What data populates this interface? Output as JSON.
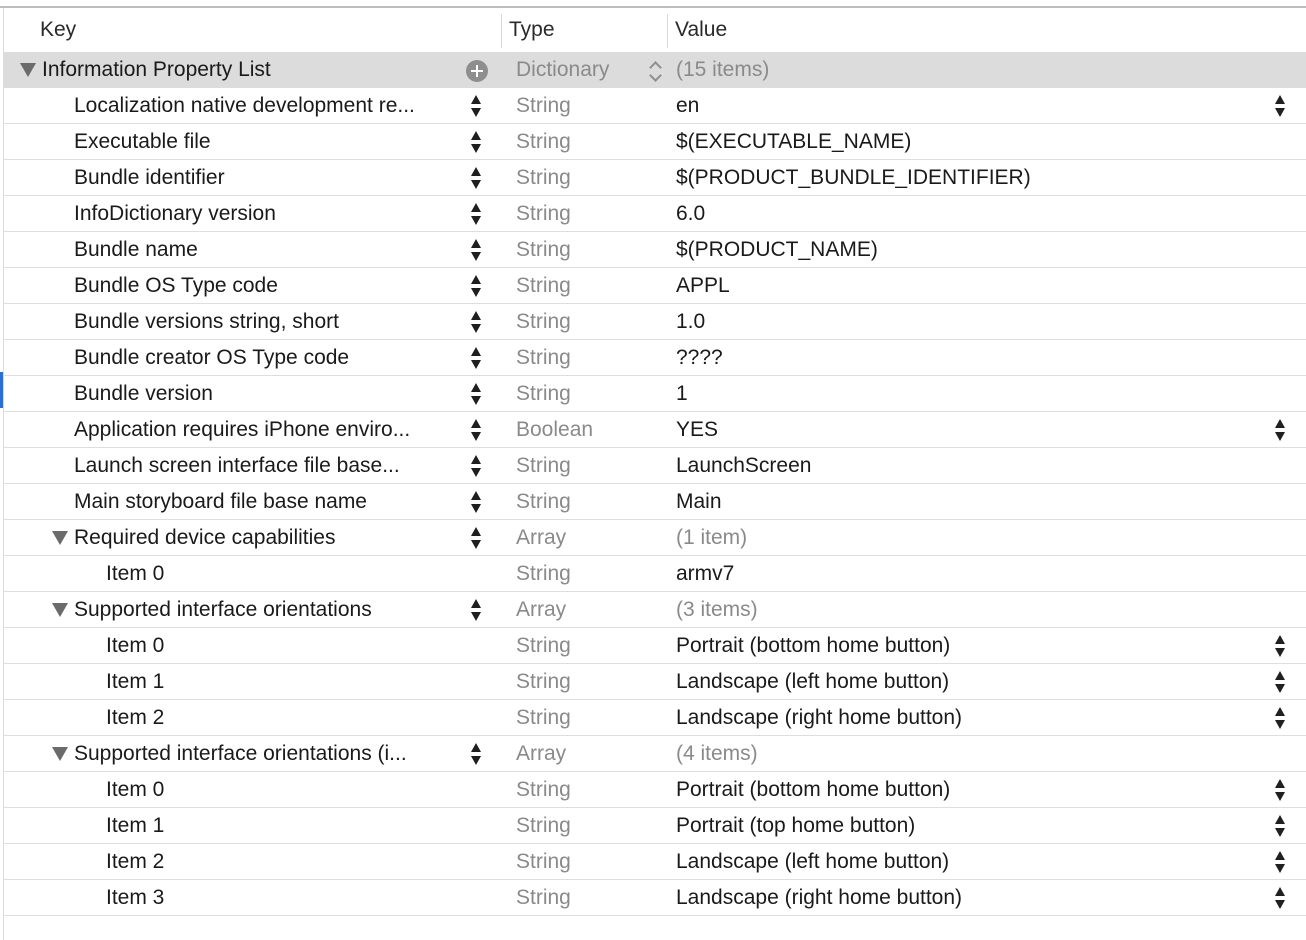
{
  "columns": {
    "key": "Key",
    "type": "Type",
    "value": "Value"
  },
  "root": {
    "key": "Information Property List",
    "type": "Dictionary",
    "value": "(15 items)"
  },
  "rows": [
    {
      "key": "Localization native development re...",
      "type": "String",
      "value": "en",
      "level": 1,
      "key_stepper": true,
      "value_stepper": true
    },
    {
      "key": "Executable file",
      "type": "String",
      "value": "$(EXECUTABLE_NAME)",
      "level": 1,
      "key_stepper": true
    },
    {
      "key": "Bundle identifier",
      "type": "String",
      "value": "$(PRODUCT_BUNDLE_IDENTIFIER)",
      "level": 1,
      "key_stepper": true
    },
    {
      "key": "InfoDictionary version",
      "type": "String",
      "value": "6.0",
      "level": 1,
      "key_stepper": true
    },
    {
      "key": "Bundle name",
      "type": "String",
      "value": "$(PRODUCT_NAME)",
      "level": 1,
      "key_stepper": true
    },
    {
      "key": "Bundle OS Type code",
      "type": "String",
      "value": "APPL",
      "level": 1,
      "key_stepper": true
    },
    {
      "key": "Bundle versions string, short",
      "type": "String",
      "value": "1.0",
      "level": 1,
      "key_stepper": true
    },
    {
      "key": "Bundle creator OS Type code",
      "type": "String",
      "value": "????",
      "level": 1,
      "key_stepper": true
    },
    {
      "key": "Bundle version",
      "type": "String",
      "value": "1",
      "level": 1,
      "key_stepper": true
    },
    {
      "key": "Application requires iPhone enviro...",
      "type": "Boolean",
      "value": "YES",
      "level": 1,
      "key_stepper": true,
      "value_stepper": true
    },
    {
      "key": "Launch screen interface file base...",
      "type": "String",
      "value": "LaunchScreen",
      "level": 1,
      "key_stepper": true
    },
    {
      "key": "Main storyboard file base name",
      "type": "String",
      "value": "Main",
      "level": 1,
      "key_stepper": true
    },
    {
      "key": "Required device capabilities",
      "type": "Array",
      "value": "(1 item)",
      "level": 1,
      "expanded": true,
      "key_stepper": true,
      "muted_value": true
    },
    {
      "key": "Item 0",
      "type": "String",
      "value": "armv7",
      "level": 2
    },
    {
      "key": "Supported interface orientations",
      "type": "Array",
      "value": "(3 items)",
      "level": 1,
      "expanded": true,
      "key_stepper": true,
      "muted_value": true
    },
    {
      "key": "Item 0",
      "type": "String",
      "value": "Portrait (bottom home button)",
      "level": 2,
      "value_stepper": true
    },
    {
      "key": "Item 1",
      "type": "String",
      "value": "Landscape (left home button)",
      "level": 2,
      "value_stepper": true
    },
    {
      "key": "Item 2",
      "type": "String",
      "value": "Landscape (right home button)",
      "level": 2,
      "value_stepper": true
    },
    {
      "key": "Supported interface orientations (i...",
      "type": "Array",
      "value": "(4 items)",
      "level": 1,
      "expanded": true,
      "key_stepper": true,
      "muted_value": true
    },
    {
      "key": "Item 0",
      "type": "String",
      "value": "Portrait (bottom home button)",
      "level": 2,
      "value_stepper": true
    },
    {
      "key": "Item 1",
      "type": "String",
      "value": "Portrait (top home button)",
      "level": 2,
      "value_stepper": true
    },
    {
      "key": "Item 2",
      "type": "String",
      "value": "Landscape (left home button)",
      "level": 2,
      "value_stepper": true
    },
    {
      "key": "Item 3",
      "type": "String",
      "value": "Landscape (right home button)",
      "level": 2,
      "value_stepper": true
    }
  ]
}
